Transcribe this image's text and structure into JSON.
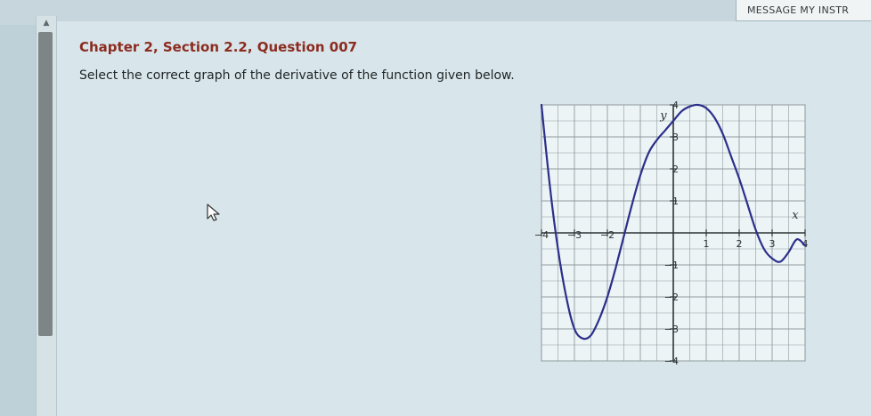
{
  "header": {
    "message_button_label": "MESSAGE MY INSTR"
  },
  "question": {
    "title": "Chapter 2, Section 2.2, Question 007",
    "prompt": "Select the correct graph of the derivative of the function given below."
  },
  "graph": {
    "x_axis_label": "x",
    "y_axis_label": "y",
    "x_tick_labels": [
      "-4",
      "-3",
      "-2",
      "1",
      "2",
      "3",
      "4"
    ],
    "y_tick_labels": [
      "4",
      "3",
      "2",
      "1",
      "-1",
      "-2",
      "-3",
      "-4"
    ],
    "curve_color": "#2b2f8a",
    "grid_color": "#8e9a9e",
    "axis_color": "#2d3436"
  },
  "chart_data": {
    "type": "line",
    "xlim": [
      -4,
      4
    ],
    "ylim": [
      -4,
      4
    ],
    "xlabel": "x",
    "ylabel": "y",
    "grid": true,
    "series": [
      {
        "x": [
          -4.0,
          -3.75,
          -3.5,
          -3.25,
          -3.0,
          -2.75,
          -2.5,
          -2.25,
          -2.0,
          -1.75,
          -1.5,
          -1.25,
          -1.0,
          -0.75,
          -0.5,
          -0.25,
          0.0,
          0.25,
          0.5,
          0.75,
          1.0,
          1.25,
          1.5,
          1.75,
          2.0,
          2.25,
          2.5,
          2.75,
          3.0,
          3.25,
          3.5,
          3.75,
          4.0
        ],
        "y": [
          4.0,
          1.5,
          -0.5,
          -2.0,
          -3.0,
          -3.3,
          -3.2,
          -2.7,
          -2.0,
          -1.1,
          -0.1,
          0.9,
          1.8,
          2.5,
          2.9,
          3.2,
          3.5,
          3.8,
          3.95,
          4.0,
          3.9,
          3.6,
          3.1,
          2.4,
          1.7,
          0.9,
          0.1,
          -0.5,
          -0.8,
          -0.9,
          -0.6,
          -0.2,
          -0.4
        ]
      }
    ]
  }
}
